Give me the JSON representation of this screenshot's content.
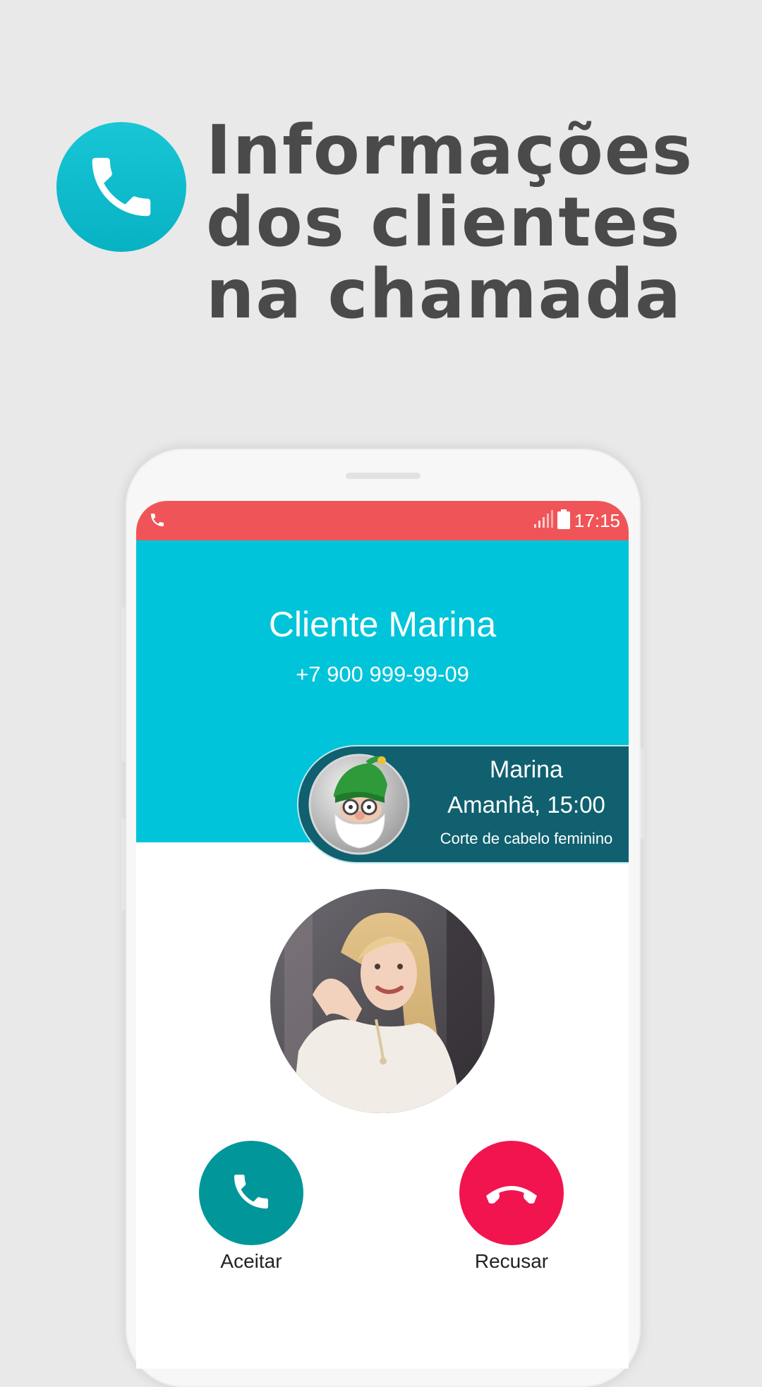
{
  "promo": {
    "headline_lines": [
      "Informações",
      "dos clientes",
      "na chamada"
    ],
    "icon": "phone-icon"
  },
  "status_bar": {
    "time": "17:15",
    "left_icon": "phone-icon",
    "right_icons": [
      "signal-icon",
      "battery-icon"
    ]
  },
  "call": {
    "caller_name": "Cliente Marina",
    "caller_phone": "+7 900 999-99-09"
  },
  "info_card": {
    "name": "Marina",
    "appointment": "Amanhã, 15:00",
    "service": "Corte de cabelo feminino",
    "avatar": "gnome-avatar"
  },
  "actions": {
    "accept_label": "Aceitar",
    "decline_label": "Recusar"
  },
  "colors": {
    "accent": "#00c4d9",
    "status_bar": "#ef5558",
    "card": "#10606f",
    "accept": "#00969a",
    "decline": "#f2144f",
    "headline_text": "#4a4a4a"
  }
}
